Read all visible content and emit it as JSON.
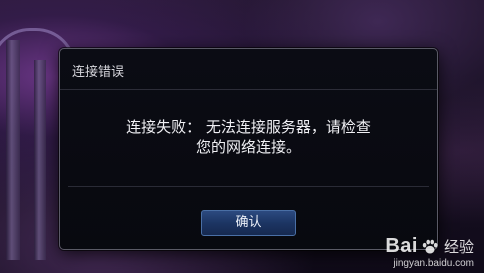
{
  "dialog": {
    "title": "连接错误",
    "message_line1": "连接失败： 无法连接服务器，请检查",
    "message_line2": "您的网络连接。",
    "ok_label": "确认"
  },
  "watermark": {
    "logo_prefix": "Bai",
    "logo_icon": "paw-icon",
    "logo_suffix": "经验",
    "url": "jingyan.baidu.com"
  },
  "colors": {
    "dialog_bg": "#08090f",
    "dialog_border": "#5a5a66",
    "button_bg": "#1c3563",
    "button_border": "#4a6fa5",
    "text": "#f0f0f4"
  }
}
